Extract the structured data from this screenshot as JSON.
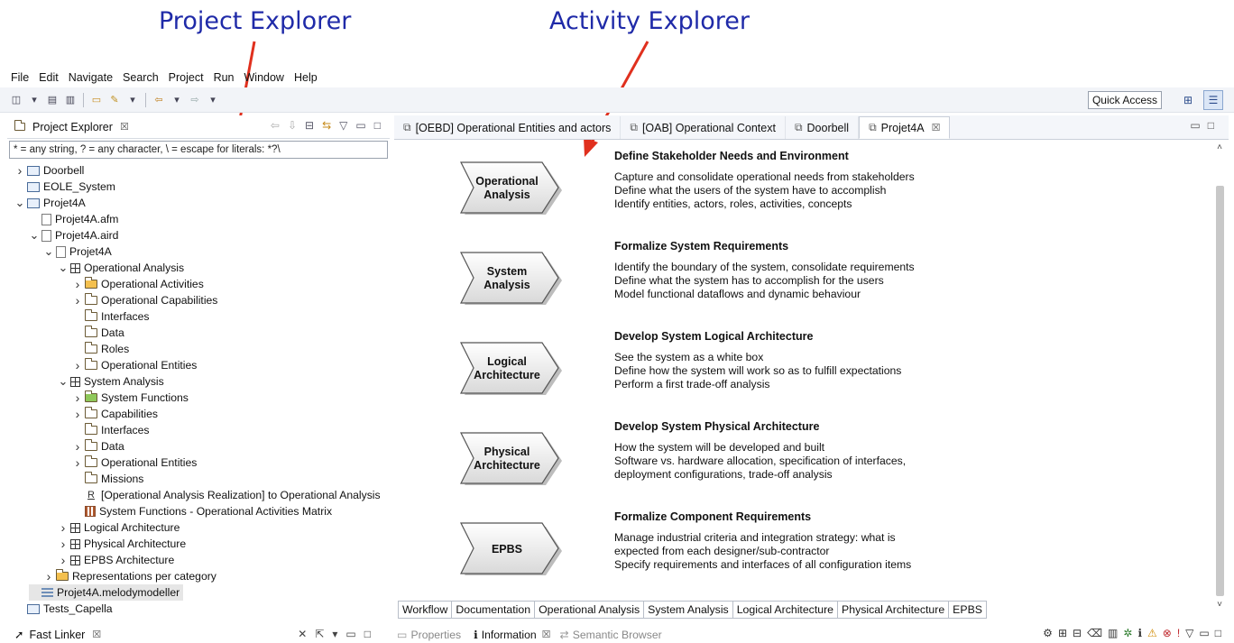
{
  "annotations": {
    "project_explorer": "Project Explorer",
    "activity_explorer": "Activity Explorer"
  },
  "menu": [
    "File",
    "Edit",
    "Navigate",
    "Search",
    "Project",
    "Run",
    "Window",
    "Help"
  ],
  "toolbar": {
    "quick_access": "Quick Access"
  },
  "left_panel": {
    "title": "Project Explorer",
    "filter_value": "* = any string, ? = any character, \\ = escape for literals: *?\\",
    "tree": [
      {
        "label": "Doorbell",
        "twisty": ">",
        "icon": "project-icon"
      },
      {
        "label": "EOLE_System",
        "twisty": "",
        "icon": "project-icon"
      },
      {
        "label": "Projet4A",
        "twisty": "v",
        "icon": "project-icon"
      },
      {
        "label": "Projet4A.afm",
        "twisty": "",
        "icon": "file-icon"
      },
      {
        "label": "Projet4A.aird",
        "twisty": "v",
        "icon": "file-icon"
      },
      {
        "label": "Projet4A",
        "twisty": "v",
        "icon": "model-icon"
      },
      {
        "label": "Operational Analysis",
        "twisty": "v",
        "icon": "grid-icon"
      },
      {
        "label": "Operational Activities",
        "twisty": ">",
        "icon": "folder-yellow-icon"
      },
      {
        "label": "Operational Capabilities",
        "twisty": ">",
        "icon": "folder-icon"
      },
      {
        "label": "Interfaces",
        "twisty": "",
        "icon": "folder-icon"
      },
      {
        "label": "Data",
        "twisty": "",
        "icon": "folder-icon"
      },
      {
        "label": "Roles",
        "twisty": "",
        "icon": "folder-icon"
      },
      {
        "label": "Operational Entities",
        "twisty": ">",
        "icon": "folder-icon"
      },
      {
        "label": "System Analysis",
        "twisty": "v",
        "icon": "grid-icon"
      },
      {
        "label": "System Functions",
        "twisty": ">",
        "icon": "folder-green-icon"
      },
      {
        "label": "Capabilities",
        "twisty": ">",
        "icon": "folder-icon"
      },
      {
        "label": "Interfaces",
        "twisty": "",
        "icon": "folder-icon"
      },
      {
        "label": "Data",
        "twisty": ">",
        "icon": "folder-icon"
      },
      {
        "label": "Operational Entities",
        "twisty": ">",
        "icon": "folder-icon"
      },
      {
        "label": "Missions",
        "twisty": "",
        "icon": "folder-icon"
      },
      {
        "label": "[Operational Analysis Realization] to Operational Analysis",
        "twisty": "",
        "icon": "realization-icon"
      },
      {
        "label": "System Functions - Operational Activities Matrix",
        "twisty": "",
        "icon": "matrix-icon"
      },
      {
        "label": "Logical Architecture",
        "twisty": ">",
        "icon": "grid-icon"
      },
      {
        "label": "Physical Architecture",
        "twisty": ">",
        "icon": "grid-icon"
      },
      {
        "label": "EPBS Architecture",
        "twisty": ">",
        "icon": "grid-icon"
      },
      {
        "label": "Representations per category",
        "twisty": ">",
        "icon": "folder-yellow-icon"
      },
      {
        "label": "Projet4A.melodymodeller",
        "twisty": "",
        "icon": "melody-icon"
      },
      {
        "label": "Tests_Capella",
        "twisty": "",
        "icon": "project-icon"
      }
    ]
  },
  "editor": {
    "tabs": [
      {
        "label": "[OEBD] Operational Entities and actors",
        "active": false
      },
      {
        "label": "[OAB] Operational Context",
        "active": false
      },
      {
        "label": "Doorbell",
        "active": false
      },
      {
        "label": "Projet4A",
        "active": true
      }
    ],
    "phases": [
      {
        "label": "Operational\nAnalysis",
        "title": "Define Stakeholder Needs and Environment",
        "lines": [
          "Capture and consolidate operational needs from stakeholders",
          "Define what the users of the system have to accomplish",
          "Identify entities, actors, roles, activities, concepts"
        ]
      },
      {
        "label": "System\nAnalysis",
        "title": "Formalize System Requirements",
        "lines": [
          "Identify the boundary of the system, consolidate requirements",
          "Define what the system has to accomplish for the users",
          "Model functional dataflows and dynamic behaviour"
        ]
      },
      {
        "label": "Logical\nArchitecture",
        "title": "Develop System Logical Architecture",
        "lines": [
          "See the system as a white box",
          "Define how the system will work so as to fulfill expectations",
          "Perform a first trade-off analysis"
        ]
      },
      {
        "label": "Physical\nArchitecture",
        "title": "Develop System Physical Architecture",
        "lines": [
          "How the system will be developed and built",
          "Software vs. hardware allocation, specification of interfaces,",
          "deployment configurations, trade-off analysis"
        ]
      },
      {
        "label": "EPBS",
        "title": "Formalize Component Requirements",
        "lines": [
          "Manage industrial criteria and integration strategy: what is",
          "expected from each designer/sub-contractor",
          "Specify requirements and interfaces of all configuration items"
        ]
      }
    ],
    "bottom_tabs": [
      "Workflow",
      "Documentation",
      "Operational Analysis",
      "System Analysis",
      "Logical Architecture",
      "Physical Architecture",
      "EPBS"
    ]
  },
  "status": {
    "left_view": "Fast Linker",
    "right_tabs": [
      "Properties",
      "Information",
      "Semantic Browser"
    ]
  }
}
